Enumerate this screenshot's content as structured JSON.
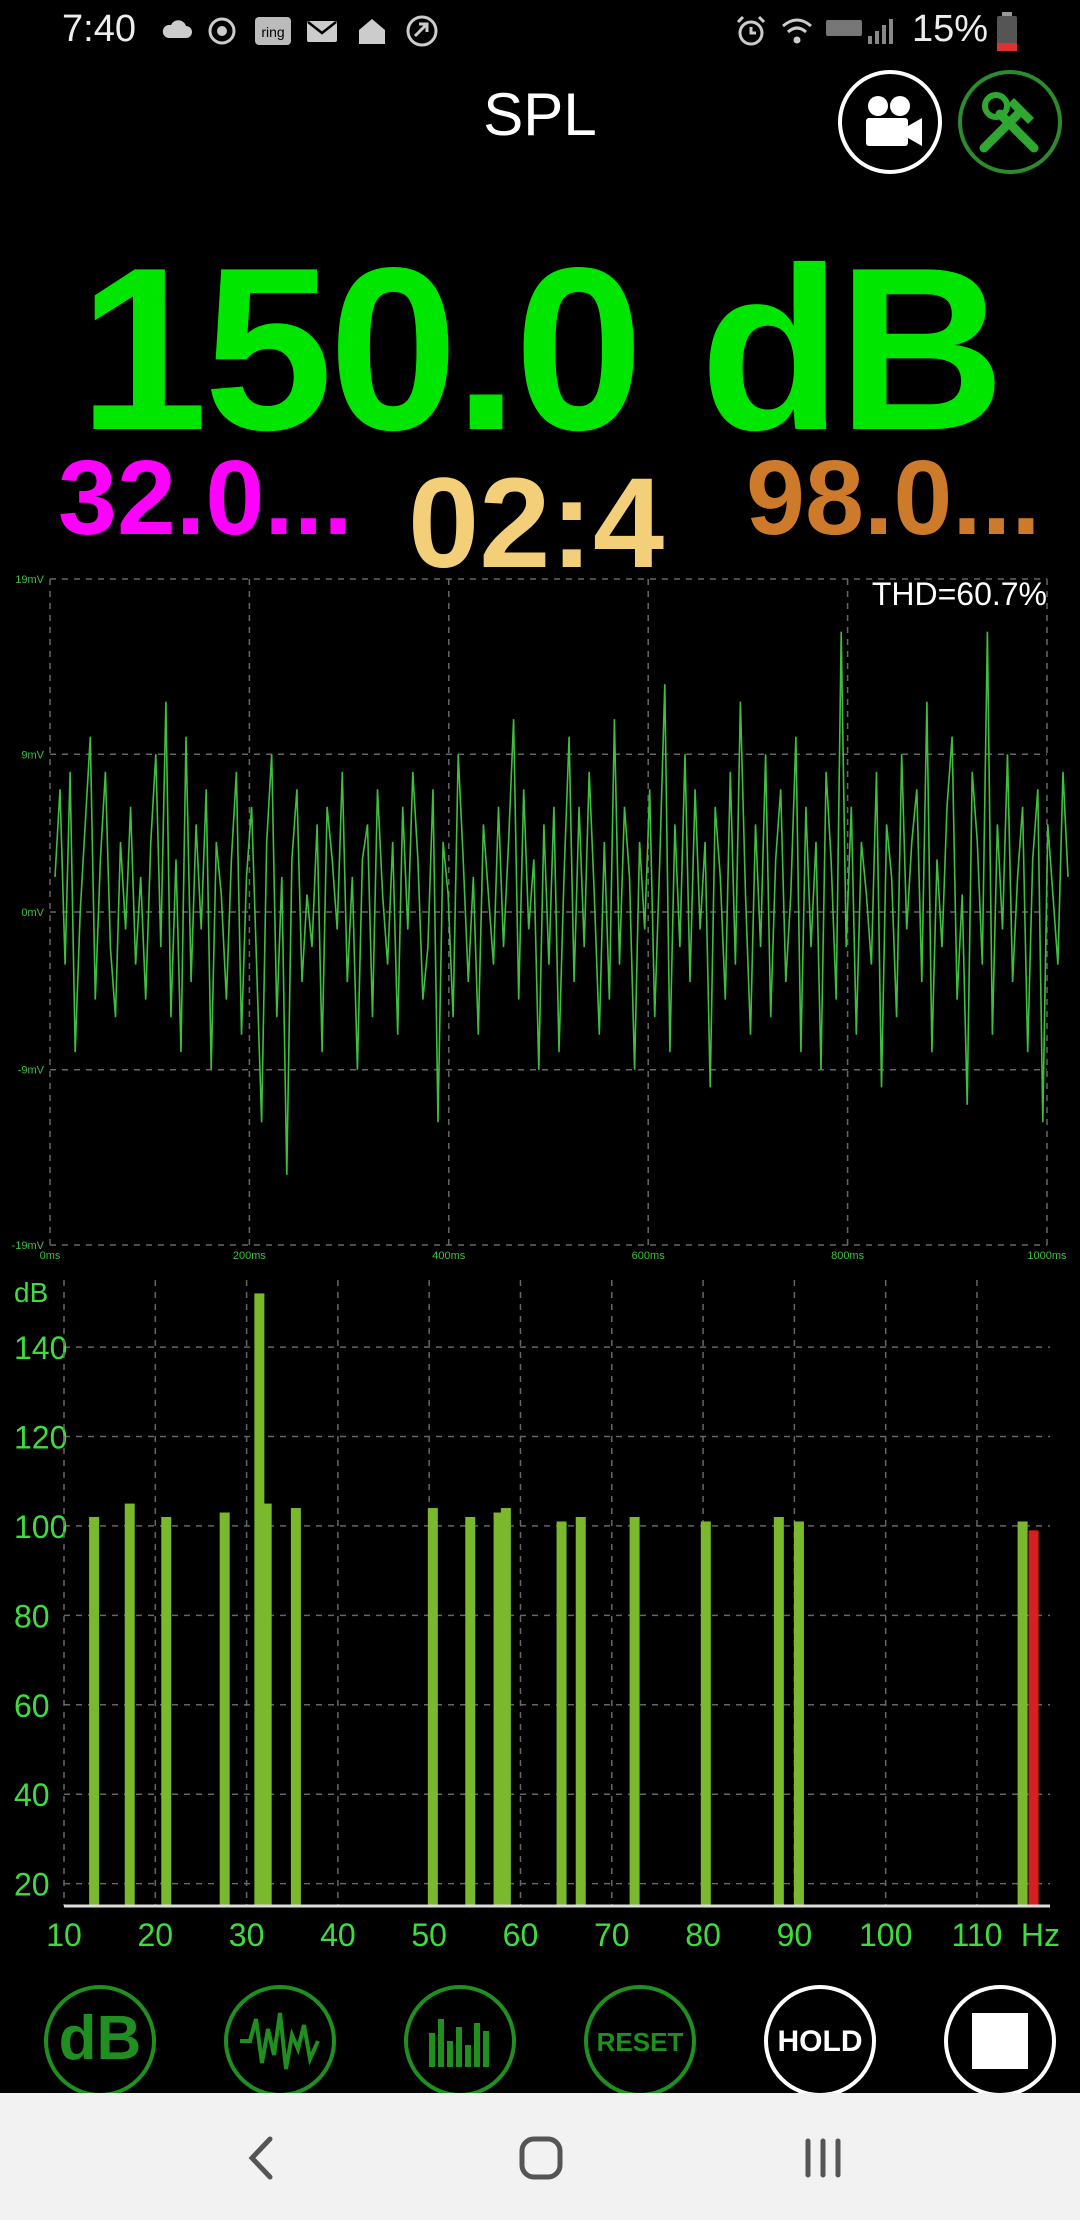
{
  "status_bar": {
    "time": "7:40",
    "battery": "15%",
    "left_icons": [
      "cloud-icon",
      "sync-icon",
      "ring-icon",
      "mail-icon",
      "home-icon",
      "cast-icon"
    ],
    "right_icons": [
      "alarm-icon",
      "wifi-icon",
      "lte-icon",
      "signal-icon",
      "battery-icon"
    ],
    "ring_label": "ring"
  },
  "header": {
    "title": "SPL",
    "video_button": "video-camera-icon",
    "tools_button": "tools-icon"
  },
  "readout": {
    "spl": "150.0 dB",
    "min": "32.0...",
    "timer": "02:4",
    "max": "98.0...",
    "colors": {
      "spl": "#00e600",
      "min": "#ff00ff",
      "timer": "#f4cf7a",
      "max": "#cd7a2a"
    }
  },
  "chart_data": [
    {
      "type": "line",
      "title": "",
      "annotation": "THD=60.7%",
      "y_ticks": [
        "19mV",
        "9mV",
        "0mV",
        "-9mV",
        "-19mV"
      ],
      "x_ticks": [
        "0ms",
        "200ms",
        "400ms",
        "600ms",
        "800ms",
        "1000ms"
      ],
      "ylim": [
        -19,
        19
      ],
      "xlim": [
        0,
        1000
      ],
      "grid": true,
      "series": [
        {
          "color": "#3fbf3f",
          "y": [
            2,
            7,
            -3,
            8,
            -8,
            0,
            5,
            10,
            -5,
            3,
            8,
            -2,
            -6,
            4,
            -1,
            6,
            -3,
            2,
            -5,
            4,
            9,
            -2,
            12,
            -6,
            3,
            -8,
            10,
            -4,
            5,
            -1,
            7,
            -9,
            4,
            1,
            -5,
            3,
            8,
            -7,
            2,
            6,
            -3,
            -12,
            4,
            9,
            -6,
            2,
            -15,
            3,
            7,
            -4,
            1,
            -2,
            5,
            -8,
            6,
            3,
            -1,
            8,
            -4,
            2,
            -9,
            3,
            5,
            -6,
            7,
            1,
            -3,
            4,
            -7,
            6,
            -1,
            8,
            3,
            -5,
            -2,
            7,
            -12,
            4,
            1,
            -6,
            9,
            3,
            -4,
            2,
            -7,
            5,
            1,
            -3,
            6,
            -2,
            4,
            11,
            -5,
            7,
            -1,
            3,
            -9,
            5,
            -3,
            6,
            -8,
            2,
            10,
            -4,
            6,
            -2,
            8,
            1,
            -7,
            4,
            -5,
            11,
            -3,
            6,
            2,
            -9,
            4,
            -1,
            7,
            -6,
            3,
            13,
            -8,
            5,
            -2,
            9,
            -4,
            7,
            -1,
            4,
            -10,
            6,
            2,
            -5,
            8,
            -3,
            12,
            1,
            -7,
            5,
            -2,
            9,
            -6,
            3,
            7,
            -4,
            1,
            10,
            -8,
            6,
            -2,
            4,
            -9,
            8,
            3,
            -5,
            16,
            -2,
            6,
            -7,
            4,
            1,
            -3,
            8,
            -10,
            5,
            2,
            -6,
            9,
            -1,
            4,
            7,
            -4,
            12,
            -8,
            3,
            -2,
            6,
            10,
            -5,
            1,
            -11,
            8,
            4,
            -3,
            16,
            -7,
            5,
            -1,
            9,
            -4,
            2,
            6,
            -8,
            3,
            7,
            -12,
            5,
            1,
            -3,
            8,
            2
          ]
        }
      ]
    },
    {
      "type": "bar",
      "title": "",
      "ylabel": "dB",
      "xlabel": "Hz",
      "x_ticks": [
        "10",
        "20",
        "30",
        "40",
        "50",
        "60",
        "70",
        "80",
        "90",
        "100",
        "110"
      ],
      "y_ticks": [
        "20",
        "40",
        "60",
        "80",
        "100",
        "120",
        "140"
      ],
      "xlim": [
        10,
        118
      ],
      "ylim": [
        15,
        155
      ],
      "grid": true,
      "bar_color": "#7ab82e",
      "peak_color": "#d42020",
      "bars": [
        {
          "x": 13.3,
          "value": 102
        },
        {
          "x": 17.2,
          "value": 105
        },
        {
          "x": 21.2,
          "value": 102
        },
        {
          "x": 27.6,
          "value": 103
        },
        {
          "x": 31.4,
          "value": 152
        },
        {
          "x": 32.2,
          "value": 105
        },
        {
          "x": 35.4,
          "value": 104
        },
        {
          "x": 50.4,
          "value": 104
        },
        {
          "x": 54.5,
          "value": 102
        },
        {
          "x": 57.6,
          "value": 103
        },
        {
          "x": 58.4,
          "value": 104
        },
        {
          "x": 64.5,
          "value": 101
        },
        {
          "x": 66.6,
          "value": 102
        },
        {
          "x": 72.5,
          "value": 102
        },
        {
          "x": 80.3,
          "value": 101
        },
        {
          "x": 88.3,
          "value": 102
        },
        {
          "x": 90.5,
          "value": 101
        },
        {
          "x": 115.0,
          "value": 101
        },
        {
          "x": 116.2,
          "value": 99,
          "peak": true
        }
      ]
    }
  ],
  "bottom_buttons": [
    {
      "name": "db-mode-button",
      "label": "dB",
      "style": "green"
    },
    {
      "name": "waveform-mode-button",
      "label": "",
      "style": "green"
    },
    {
      "name": "spectrum-mode-button",
      "label": "",
      "style": "green"
    },
    {
      "name": "reset-button",
      "label": "RESET",
      "style": "green"
    },
    {
      "name": "hold-button",
      "label": "HOLD",
      "style": "white"
    },
    {
      "name": "stop-button",
      "label": "",
      "style": "white"
    }
  ],
  "nav_bar": [
    "back-icon",
    "home-icon",
    "recents-icon"
  ]
}
